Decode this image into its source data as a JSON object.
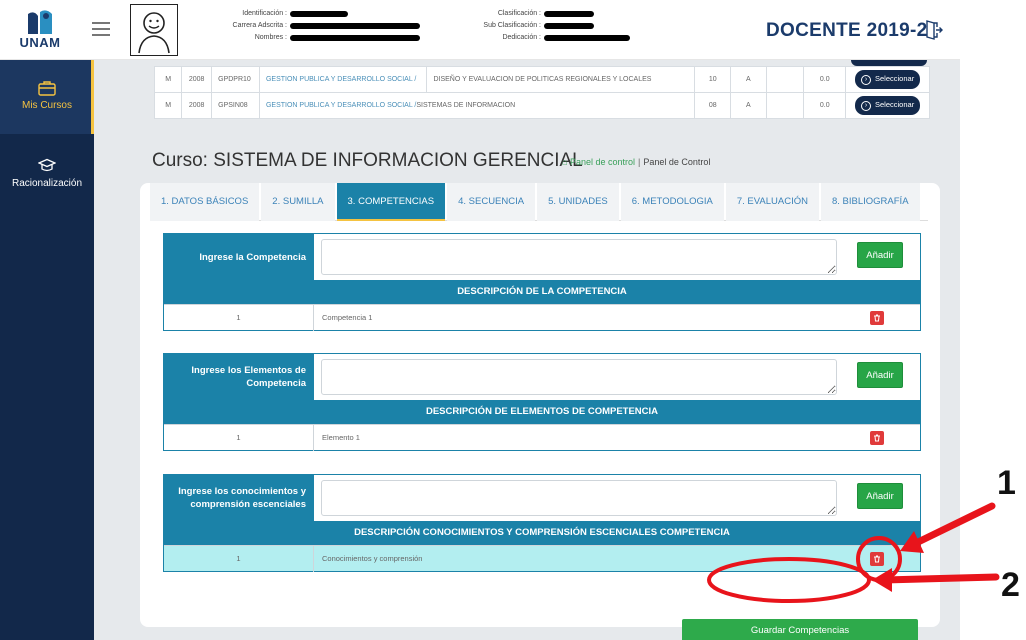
{
  "header": {
    "logo_text": "UNAM",
    "info_left": [
      {
        "label": "Identificación :"
      },
      {
        "label": "Carrera Adscrita :"
      },
      {
        "label": "Nombres :"
      }
    ],
    "info_right": [
      {
        "label": "Clasificación :"
      },
      {
        "label": "Sub Clasificación :"
      },
      {
        "label": "Dedicación :"
      }
    ],
    "role_title": "DOCENTE 2019-2"
  },
  "sidebar": {
    "items": [
      {
        "label": "Mis Cursos",
        "icon": "briefcase-icon",
        "active": true
      },
      {
        "label": "Racionalización",
        "icon": "graduation-cap-icon",
        "active": false
      }
    ]
  },
  "courses_table": {
    "rows": [
      {
        "col1": "M",
        "year": "2008",
        "code": "GPDPR10",
        "program": "GESTION PUBLICA Y DESARROLLO SOCIAL /",
        "course": "DISEÑO Y EVALUACION DE POLITICAS REGIONALES Y LOCALES",
        "cycle": "10",
        "section": "A",
        "extra": "",
        "score": "0.0",
        "action": "Seleccionar"
      },
      {
        "col1": "M",
        "year": "2008",
        "code": "GPSIN08",
        "program": "GESTION PUBLICA Y DESARROLLO SOCIAL /",
        "course": "SISTEMAS DE INFORMACION",
        "cycle": "08",
        "section": "A",
        "extra": "",
        "score": "0.0",
        "action": "Seleccionar"
      }
    ]
  },
  "course": {
    "title": "Curso: SISTEMA DE INFORMACION GERENCIAL",
    "breadcrumb_home": "Panel de control",
    "breadcrumb_sep": "|",
    "breadcrumb_current": "Panel de Control"
  },
  "tabs": [
    {
      "label": "1. DATOS BÁSICOS",
      "active": false
    },
    {
      "label": "2. SUMILLA",
      "active": false
    },
    {
      "label": "3. COMPETENCIAS",
      "active": true
    },
    {
      "label": "4. SECUENCIA",
      "active": false
    },
    {
      "label": "5. UNIDADES",
      "active": false
    },
    {
      "label": "6. METODOLOGIA",
      "active": false
    },
    {
      "label": "7. EVALUACIÓN",
      "active": false
    },
    {
      "label": "8. BIBLIOGRAFÍA",
      "active": false
    }
  ],
  "blocks": [
    {
      "input_label": "Ingrese la Competencia",
      "input_value": "",
      "add_label": "Añadir",
      "header": "DESCRIPCIÓN DE LA COMPETENCIA",
      "row_num": "1",
      "row_desc": "Competencia 1"
    },
    {
      "input_label": "Ingrese los Elementos de Competencia",
      "input_value": "",
      "add_label": "Añadir",
      "header": "DESCRIPCIÓN DE ELEMENTOS DE COMPETENCIA",
      "row_num": "1",
      "row_desc": "Elemento 1"
    },
    {
      "input_label": "Ingrese los conocimientos y comprensión escenciales",
      "input_value": "",
      "add_label": "Añadir",
      "header": "DESCRIPCIÓN CONOCIMIENTOS Y COMPRENSIÓN ESCENCIALES COMPETENCIA",
      "row_num": "1",
      "row_desc": "Conocimientos y comprensión"
    }
  ],
  "save_label": "Guardar Competencias",
  "annotations": {
    "marker_1": "1",
    "marker_2": "2",
    "color": "#e8141b"
  },
  "colors": {
    "sidebar": "#12284a",
    "accent": "#1b82a8",
    "active_tab_underline": "#f5c341",
    "success": "#2eaa4b",
    "danger": "#e03a3a"
  }
}
